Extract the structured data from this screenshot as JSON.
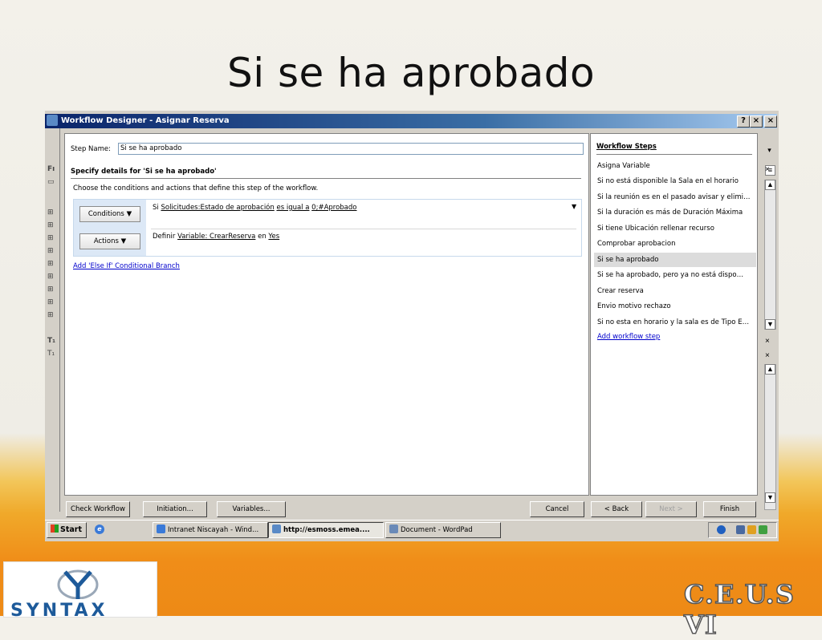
{
  "slide": {
    "title": "Si se ha aprobado"
  },
  "window": {
    "title": "Workflow Designer - Asignar Reserva",
    "help": "?",
    "close": "×"
  },
  "left_strip": {
    "labels": [
      "Fı",
      "T₁",
      "T₁"
    ]
  },
  "main": {
    "step_name_label": "Step Name:",
    "step_name_value": "Si se ha aprobado",
    "specify_heading": "Specify details for 'Si se ha aprobado'",
    "instructions": "Choose the conditions and actions that define this step of the workflow.",
    "conditions_button": "Conditions ▼",
    "actions_button": "Actions ▼",
    "condition": {
      "prefix": "Si",
      "field": "Solicitudes:Estado de aprobación",
      "operator": "es igual a",
      "value": "0;#Aprobado"
    },
    "action": {
      "prefix": "Definir",
      "variable": "Variable: CrearReserva",
      "connector": "en",
      "value": "Yes"
    },
    "else_if_link": "Add 'Else If' Conditional Branch"
  },
  "steps": {
    "title": "Workflow Steps",
    "items": [
      "Asigna Variable",
      "Si no está disponible la Sala en el horario",
      "Si la reunión es en el pasado avisar y elimi…",
      "Si la duración es más de Duración Máxima",
      "Si tiene Ubicación rellenar recurso",
      "Comprobar aprobacion",
      "Si se ha aprobado",
      "Si se ha aprobado, pero ya no está dispo…",
      "Crear reserva",
      "Envio motivo rechazo",
      "Si no esta en horario y la sala es de Tipo E…"
    ],
    "selected_index": 6,
    "add_step_link": "Add workflow step"
  },
  "buttons": {
    "check_workflow": "Check Workflow",
    "initiation": "Initiation...",
    "variables": "Variables...",
    "cancel": "Cancel",
    "back": "< Back",
    "next": "Next >",
    "finish": "Finish"
  },
  "taskbar": {
    "start": "Start",
    "tasks": [
      "Intranet Niscayah - Wind...",
      "http://esmoss.emea....",
      "Document - WordPad"
    ]
  },
  "logos": {
    "left": "SYNTAX",
    "right": "C.E.U.S VI"
  },
  "colors": {
    "title_bar": "#0a246a",
    "link": "#0000cc",
    "selected_step": "#dcdcdc",
    "condition_panel": "#dce8f6"
  }
}
